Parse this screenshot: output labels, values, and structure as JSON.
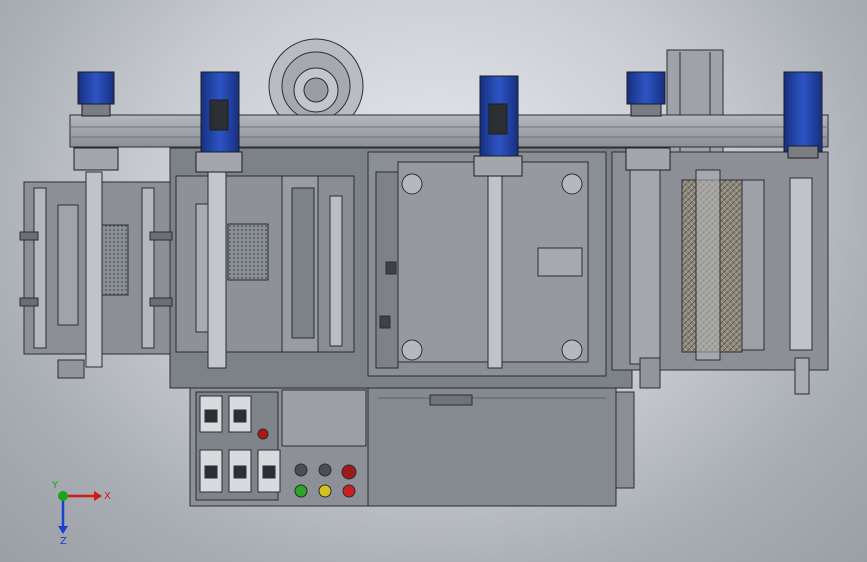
{
  "viewport": {
    "background_top": "#e6e9ec",
    "background_bottom": "#9a9fa6"
  },
  "machine": {
    "body_color": "#7b7f86",
    "frame_color": "#9ea3a9",
    "edge_color": "#2b2e33",
    "motor_color": "#1f3f9f",
    "roller_mesh_color": "#8a8578"
  },
  "control_panel": {
    "indicator_colors": [
      "#2aa52a",
      "#d8c21b",
      "#c82020"
    ],
    "emergency_stop_color": "#b31515"
  },
  "triad": {
    "x_label": "X",
    "y_label": "Y",
    "z_label": "Z",
    "x_color": "#d11a1a",
    "y_color": "#1aa51a",
    "z_color": "#1a3fd1"
  }
}
